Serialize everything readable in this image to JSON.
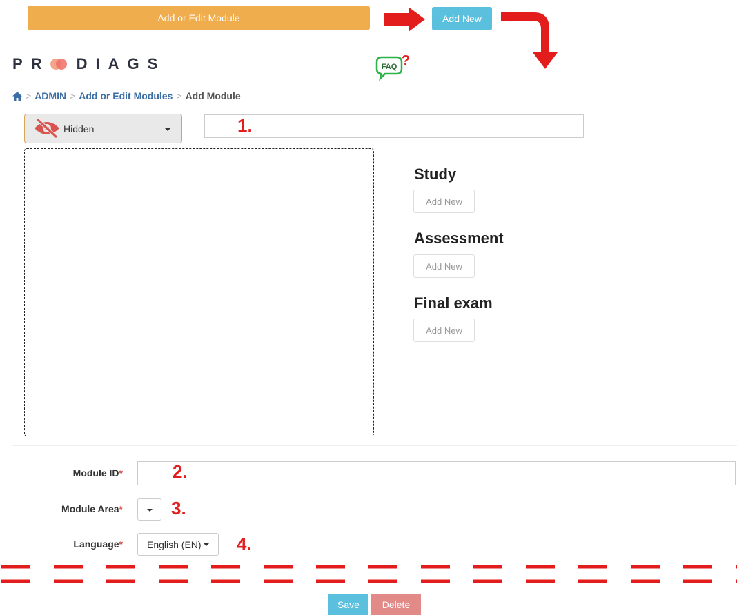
{
  "top_bar": {
    "module_bar_label": "Add or Edit Module",
    "add_new_label": "Add New"
  },
  "logo": {
    "left": "PR",
    "right": "DIAGS"
  },
  "faq": {
    "label": "FAQ",
    "mark": "?"
  },
  "breadcrumb": {
    "items": [
      "ADMIN",
      "Add or Edit Modules"
    ],
    "current": "Add Module",
    "separator": ">"
  },
  "visibility": {
    "selected": "Hidden"
  },
  "annotations": [
    "1.",
    "2.",
    "3.",
    "4."
  ],
  "sections": [
    {
      "title": "Study",
      "button": "Add New"
    },
    {
      "title": "Assessment",
      "button": "Add New"
    },
    {
      "title": "Final exam",
      "button": "Add New"
    }
  ],
  "form": {
    "module_id_label": "Module ID",
    "module_area_label": "Module Area",
    "language_label": "Language",
    "required_mark": "*",
    "language_value": "English (EN)"
  },
  "actions": {
    "save": "Save",
    "delete": "Delete"
  },
  "colors": {
    "warning": "#f0ad4e",
    "info": "#5bc0de",
    "danger_light": "#e28a87",
    "annotation_red": "#e31c1c",
    "link_blue": "#3a6ea5"
  }
}
